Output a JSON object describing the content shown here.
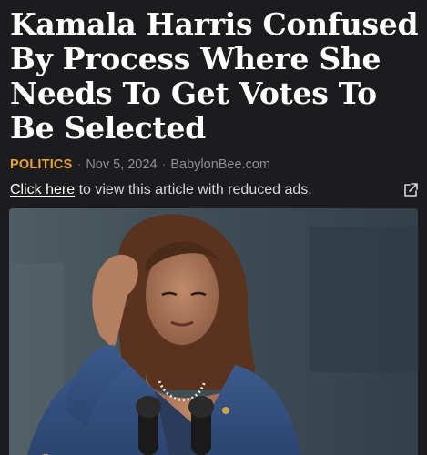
{
  "article": {
    "headline": "Kamala Harris Confused By Process Where She Needs To Get Votes To Be Selected",
    "category": "POLITICS",
    "separator": "·",
    "date": "Nov 5, 2024",
    "source": "BabylonBee.com",
    "reduced_ads_link": "Click here",
    "reduced_ads_text": " to view this article with reduced ads."
  },
  "icons": {
    "external_link": "external-link-icon",
    "bottom_bar": [
      "reader-icon",
      "close-icon",
      "tabs-icon",
      "share-icon"
    ]
  },
  "colors": {
    "background": "#1c1c1e",
    "category": "#e8a33d",
    "meta": "#8e8e93",
    "headline": "#ffffff"
  }
}
